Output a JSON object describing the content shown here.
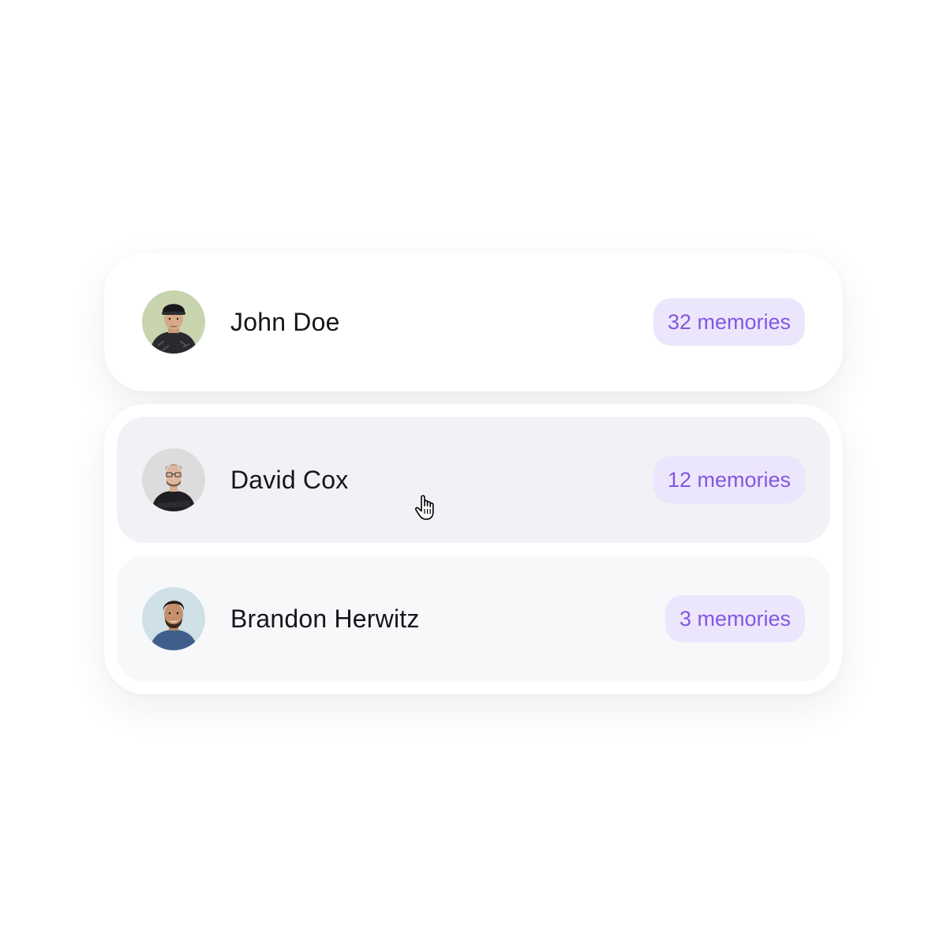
{
  "colors": {
    "badge_background": "#ece6fd",
    "badge_text": "#8457e0",
    "hover_row": "#f1f2f6",
    "plain_row": "#f7f8fa"
  },
  "contacts": [
    {
      "name": "John Doe",
      "memories": "32 memories",
      "avatar_icon": "avatar-photo-john-doe",
      "state": "default"
    },
    {
      "name": "David Cox",
      "memories": "12 memories",
      "avatar_icon": "avatar-photo-david-cox",
      "state": "hovered"
    },
    {
      "name": "Brandon Herwitz",
      "memories": "3 memories",
      "avatar_icon": "avatar-photo-brandon-herwitz",
      "state": "default"
    }
  ],
  "cursor": {
    "icon": "hand-pointer-icon"
  }
}
